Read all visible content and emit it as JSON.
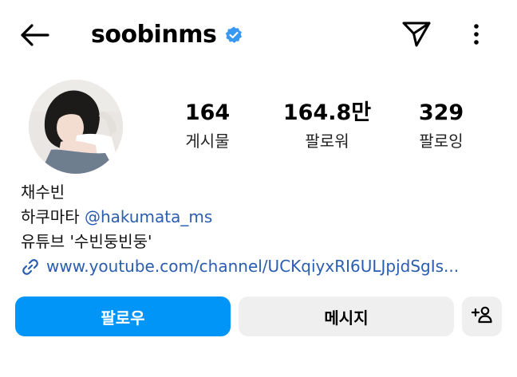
{
  "header": {
    "username": "soobinms",
    "verified": true,
    "back_icon": "arrow-left-icon",
    "send_icon": "paper-plane-icon",
    "more_icon": "vertical-dots-icon"
  },
  "profile": {
    "avatar_alt": "profile photo",
    "stats": [
      {
        "value": "164",
        "label": "게시물"
      },
      {
        "value": "164.8만",
        "label": "팔로워"
      },
      {
        "value": "329",
        "label": "팔로잉"
      }
    ]
  },
  "bio": {
    "name": "채수빈",
    "line2_prefix": "하쿠마타 ",
    "line2_mention": "@hakumata_ms",
    "line3": "유튜브 '수빈둥빈둥'",
    "link": "www.youtube.com/channel/UCKqiyxRI6ULJpjdSgIs..."
  },
  "actions": {
    "follow": "팔로우",
    "message": "메시지",
    "suggest_icon": "add-person-icon"
  },
  "colors": {
    "accent": "#0095f6",
    "link": "#2a5db0",
    "verified": "#3897f0",
    "button_secondary": "#efefef"
  }
}
